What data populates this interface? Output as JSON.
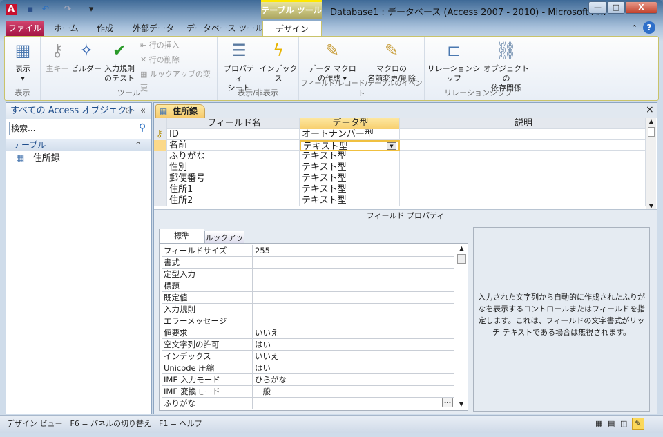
{
  "window": {
    "title": "Database1 : データベース (Access 2007 - 2010) - Microsoft A...",
    "context_tab_group": "テーブル ツール",
    "minimize": "—",
    "maximize": "□",
    "close": "X"
  },
  "quick_access": {
    "app_icon": "A",
    "save": "save-icon",
    "undo": "undo-icon",
    "redo": "redo-icon",
    "customize": "customize-icon"
  },
  "tabs": [
    {
      "label": "ファイル"
    },
    {
      "label": "ホーム"
    },
    {
      "label": "作成"
    },
    {
      "label": "外部データ"
    },
    {
      "label": "データベース ツール"
    },
    {
      "label": "デザイン",
      "active": true
    }
  ],
  "ribbon": {
    "groups": [
      {
        "label": "表示",
        "buttons": [
          {
            "label": "表示",
            "icon": "datasheet-view-icon"
          }
        ]
      },
      {
        "label": "ツール",
        "buttons": [
          {
            "label": "主キー",
            "disabled": true
          },
          {
            "label": "ビルダー"
          },
          {
            "label": "入力規則\nのテスト"
          }
        ],
        "small": [
          {
            "label": "行の挿入",
            "disabled": true
          },
          {
            "label": "行の削除",
            "disabled": true
          },
          {
            "label": "ルックアップの変更",
            "disabled": true
          }
        ]
      },
      {
        "label": "表示/非表示",
        "buttons": [
          {
            "label": "プロパティ\nシート"
          },
          {
            "label": "インデックス"
          }
        ]
      },
      {
        "label": "フィールド/レコード/テーブルのイベント",
        "buttons": [
          {
            "label": "データ マクロ\nの作成 ▾"
          },
          {
            "label": "マクロの\n名前変更/削除"
          }
        ]
      },
      {
        "label": "リレーションシップ",
        "buttons": [
          {
            "label": "リレーションシップ"
          },
          {
            "label": "オブジェクトの\n依存関係"
          }
        ]
      }
    ]
  },
  "nav": {
    "header": "すべての Access オブジェクト",
    "search_placeholder": "検索...",
    "group": "テーブル",
    "items": [
      {
        "label": "住所録"
      }
    ]
  },
  "document": {
    "tab": "住所録",
    "close": "×",
    "columns": [
      "フィールド名",
      "データ型",
      "説明"
    ],
    "rows": [
      {
        "name": "ID",
        "type": "オートナンバー型",
        "key": true
      },
      {
        "name": "名前",
        "type": "テキスト型",
        "selected": true
      },
      {
        "name": "ふりがな",
        "type": "テキスト型"
      },
      {
        "name": "性別",
        "type": "テキスト型"
      },
      {
        "name": "郵便番号",
        "type": "テキスト型"
      },
      {
        "name": "住所1",
        "type": "テキスト型"
      },
      {
        "name": "住所2",
        "type": "テキスト型"
      }
    ],
    "field_properties_label": "フィールド プロパティ",
    "prop_tabs": [
      "標準",
      "ルックアップ"
    ],
    "properties": [
      [
        "フィールドサイズ",
        "255"
      ],
      [
        "書式",
        ""
      ],
      [
        "定型入力",
        ""
      ],
      [
        "標題",
        ""
      ],
      [
        "既定値",
        ""
      ],
      [
        "入力規則",
        ""
      ],
      [
        "エラーメッセージ",
        ""
      ],
      [
        "値要求",
        "いいえ"
      ],
      [
        "空文字列の許可",
        "はい"
      ],
      [
        "インデックス",
        "いいえ"
      ],
      [
        "Unicode 圧縮",
        "はい"
      ],
      [
        "IME 入力モード",
        "ひらがな"
      ],
      [
        "IME 変換モード",
        "一般"
      ],
      [
        "ふりがな",
        ""
      ]
    ],
    "builder_button": "...",
    "help_text": "入力された文字列から自動的に作成されたふりがなを表示するコントロールまたはフィールドを指定します。これは、フィールドの文字書式がリッチ テキストである場合は無視されます。"
  },
  "status": {
    "text": "デザイン ビュー　F6 = パネルの切り替え　F1 = ヘルプ"
  },
  "colors": {
    "file_tab": "#b9204f",
    "context_tab": "#ffe800",
    "selection": "#f6c96b"
  }
}
